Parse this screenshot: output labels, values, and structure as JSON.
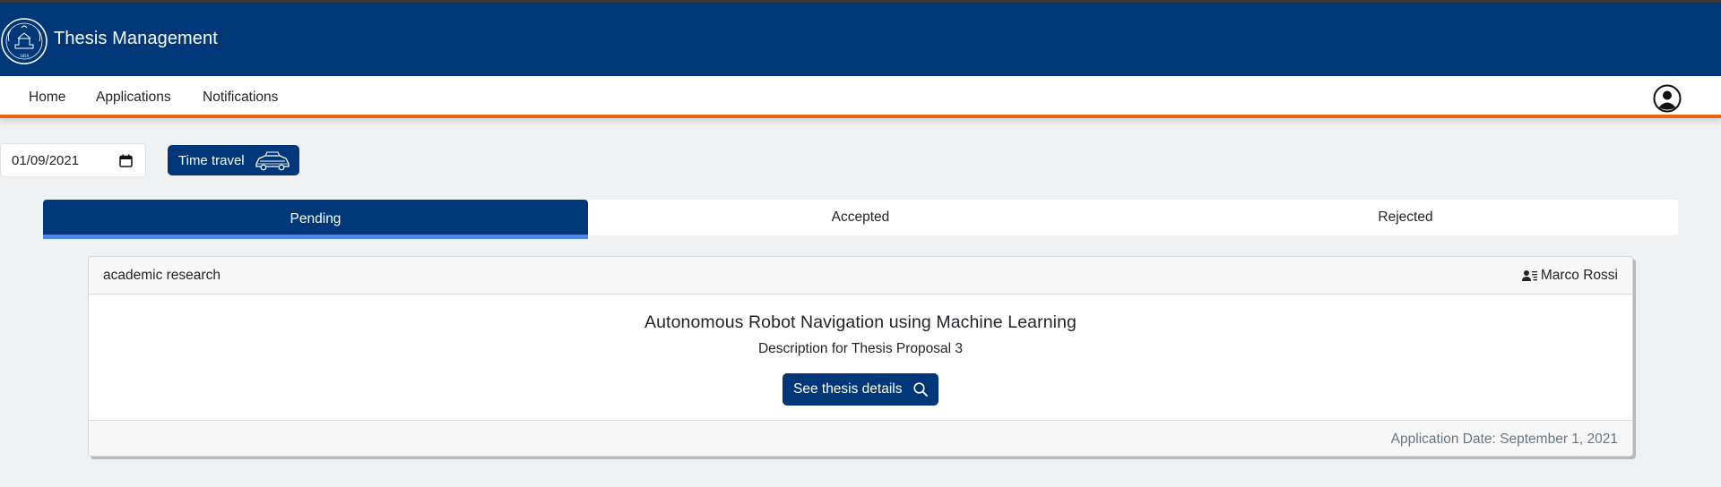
{
  "header": {
    "brand_title": "Thesis Management"
  },
  "nav": {
    "items": [
      {
        "label": "Home"
      },
      {
        "label": "Applications"
      },
      {
        "label": "Notifications"
      }
    ]
  },
  "time_travel": {
    "date_value": "01/09/2021",
    "button_label": "Time travel"
  },
  "tabs": [
    {
      "label": "Pending",
      "active": true
    },
    {
      "label": "Accepted",
      "active": false
    },
    {
      "label": "Rejected",
      "active": false
    }
  ],
  "application_card": {
    "type": "academic research",
    "supervisor": "Marco Rossi",
    "title": "Autonomous Robot Navigation using Machine Learning",
    "description": "Description for Thesis Proposal 3",
    "details_button": "See thesis details",
    "application_date": "Application Date: September 1, 2021"
  },
  "colors": {
    "brand": "#003778",
    "accent": "#e8650f",
    "tab_underline": "#4f86e8"
  },
  "icons": {
    "logo": "university-seal-icon",
    "user": "user-circle-icon",
    "calendar": "calendar-icon",
    "car": "delorean-car-icon",
    "supervisor": "person-lines-icon",
    "search": "search-icon"
  }
}
